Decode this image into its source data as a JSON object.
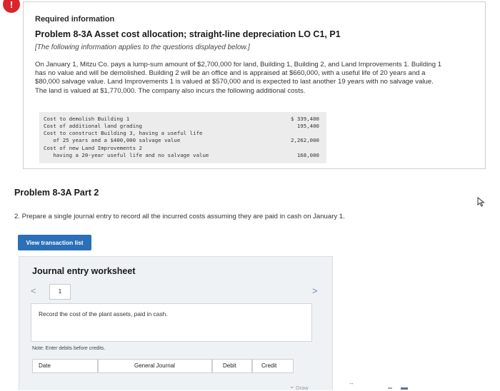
{
  "alert": {
    "symbol": "!"
  },
  "info": {
    "required_label": "Required information",
    "problem_title": "Problem 8-3A Asset cost allocation; straight-line depreciation LO C1, P1",
    "note": "[The following information applies to the questions displayed below.]",
    "paragraph": "On January 1, Mitzu Co. pays a lump-sum amount of $2,700,000 for land, Building 1, Building 2, and Land Improvements 1. Building 1 has no value and will be demolished. Building 2 will be an office and is appraised at $660,000, with a useful life of 20 years and a $80,000 salvage value. Land Improvements 1 is valued at $570,000 and is expected to last another 19 years with no salvage value. The land is valued at $1,770,000. The company also incurs the following additional costs.",
    "costs": [
      {
        "lines": [
          "Cost to demolish Building 1"
        ],
        "amount": "$  339,400"
      },
      {
        "lines": [
          "Cost of additional land grading"
        ],
        "amount": "195,400"
      },
      {
        "lines": [
          "Cost to construct Building 3, having a useful life",
          "   of 25 years and a $400,000 salvage value"
        ],
        "amount": "2,262,000"
      },
      {
        "lines": [
          "Cost of new Land Improvements 2",
          "   having a 20-year useful life and no salvage value"
        ],
        "amount": "168,000"
      }
    ]
  },
  "part": {
    "title": "Problem 8-3A Part 2",
    "question": "2. Prepare a single journal entry to record all the incurred costs assuming they are paid in cash on January 1."
  },
  "view_button": {
    "label": "View transaction list"
  },
  "worksheet": {
    "title": "Journal entry worksheet",
    "current_page": "1",
    "prev_symbol": "<",
    "next_symbol": ">",
    "record_text": "Record the cost of the plant assets, paid in cash.",
    "note": "Note: Enter debits before credits.",
    "columns": [
      "Date",
      "General Journal",
      "Debit",
      "Credit"
    ]
  },
  "footer": {
    "draw_label": "Draw"
  },
  "colors": {
    "accent_blue": "#2b6fb6",
    "alert_red": "#d9262c"
  }
}
